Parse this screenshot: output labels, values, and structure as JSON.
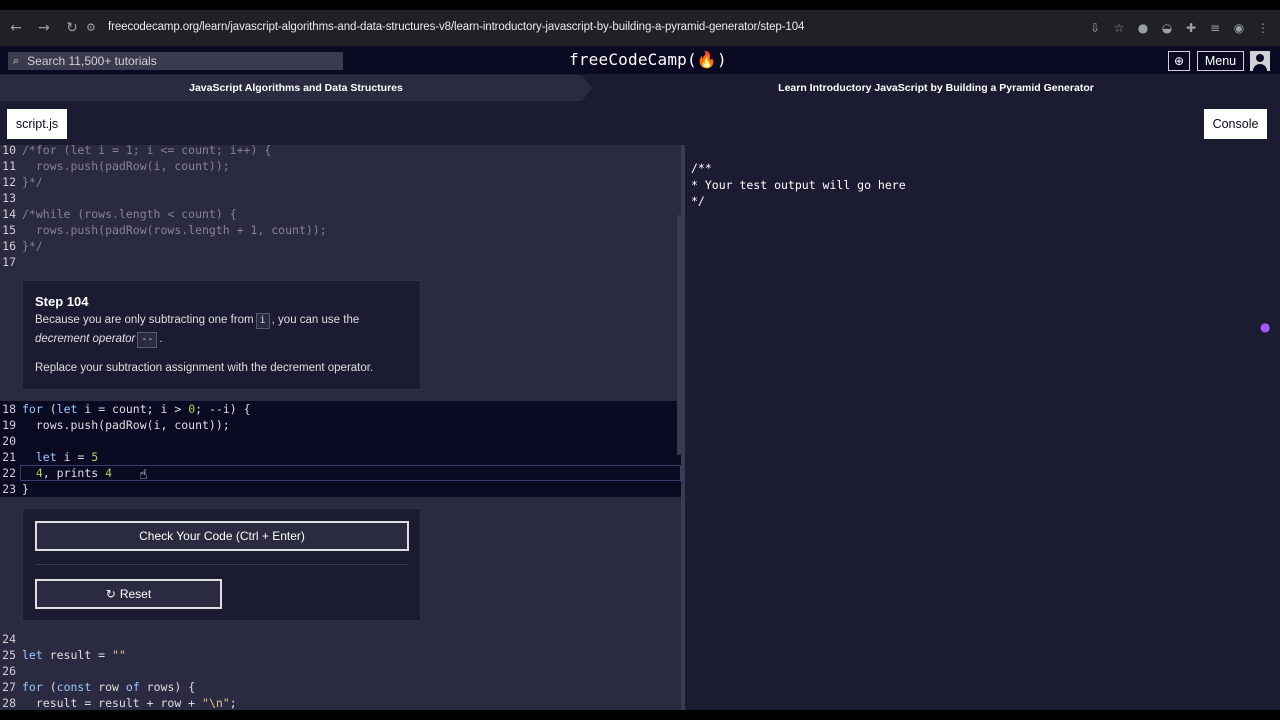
{
  "browser": {
    "url": "freecodecamp.org/learn/javascript-algorithms-and-data-structures-v8/learn-introductory-javascript-by-building-a-pyramid-generator/step-104"
  },
  "nav": {
    "search_placeholder": "Search 11,500+ tutorials",
    "logo": "freeCodeCamp(🔥)",
    "menu_label": "Menu"
  },
  "breadcrumb": {
    "left": "JavaScript Algorithms and Data Structures",
    "right": "Learn Introductory JavaScript by Building a Pyramid Generator"
  },
  "tabs": {
    "script": "script.js",
    "console": "Console"
  },
  "editor": {
    "lines_top": [
      {
        "num": "10",
        "code": "/*for (let i = 1; i <= count; i++) {"
      },
      {
        "num": "11",
        "code": "  rows.push(padRow(i, count));"
      },
      {
        "num": "12",
        "code": "}*/"
      },
      {
        "num": "13",
        "code": ""
      },
      {
        "num": "14",
        "code": "/*while (rows.length < count) {"
      },
      {
        "num": "15",
        "code": "  rows.push(padRow(rows.length + 1, count));"
      },
      {
        "num": "16",
        "code": "}*/"
      },
      {
        "num": "17",
        "code": ""
      }
    ],
    "lines_active": [
      {
        "num": "18",
        "code": "for (let i = count; i > 0; --i) {"
      },
      {
        "num": "19",
        "code": "  rows.push(padRow(i, count));"
      },
      {
        "num": "20",
        "code": ""
      },
      {
        "num": "21",
        "code": "  let i = 5"
      },
      {
        "num": "22",
        "code": "  4, prints 4"
      },
      {
        "num": "23",
        "code": "}"
      }
    ],
    "lines_bottom": [
      {
        "num": "24",
        "code": ""
      },
      {
        "num": "25",
        "code": "let result = \"\""
      },
      {
        "num": "26",
        "code": ""
      },
      {
        "num": "27",
        "code": "for (const row of rows) {"
      },
      {
        "num": "28",
        "code": "  result = result + row + \"\\n\";"
      }
    ]
  },
  "step": {
    "title": "Step 104",
    "p1_a": "Because you are only subtracting one from",
    "p1_code": "i",
    "p1_b": ", you can use the",
    "p1_em": "decrement operator",
    "p1_code2": "--",
    "p1_end": ".",
    "p2": "Replace your subtraction assignment with the decrement operator."
  },
  "actions": {
    "check": "Check Your Code (Ctrl + Enter)",
    "reset": "Reset"
  },
  "console": {
    "lines": [
      "/**",
      "* Your test output will go here",
      "*/"
    ]
  }
}
